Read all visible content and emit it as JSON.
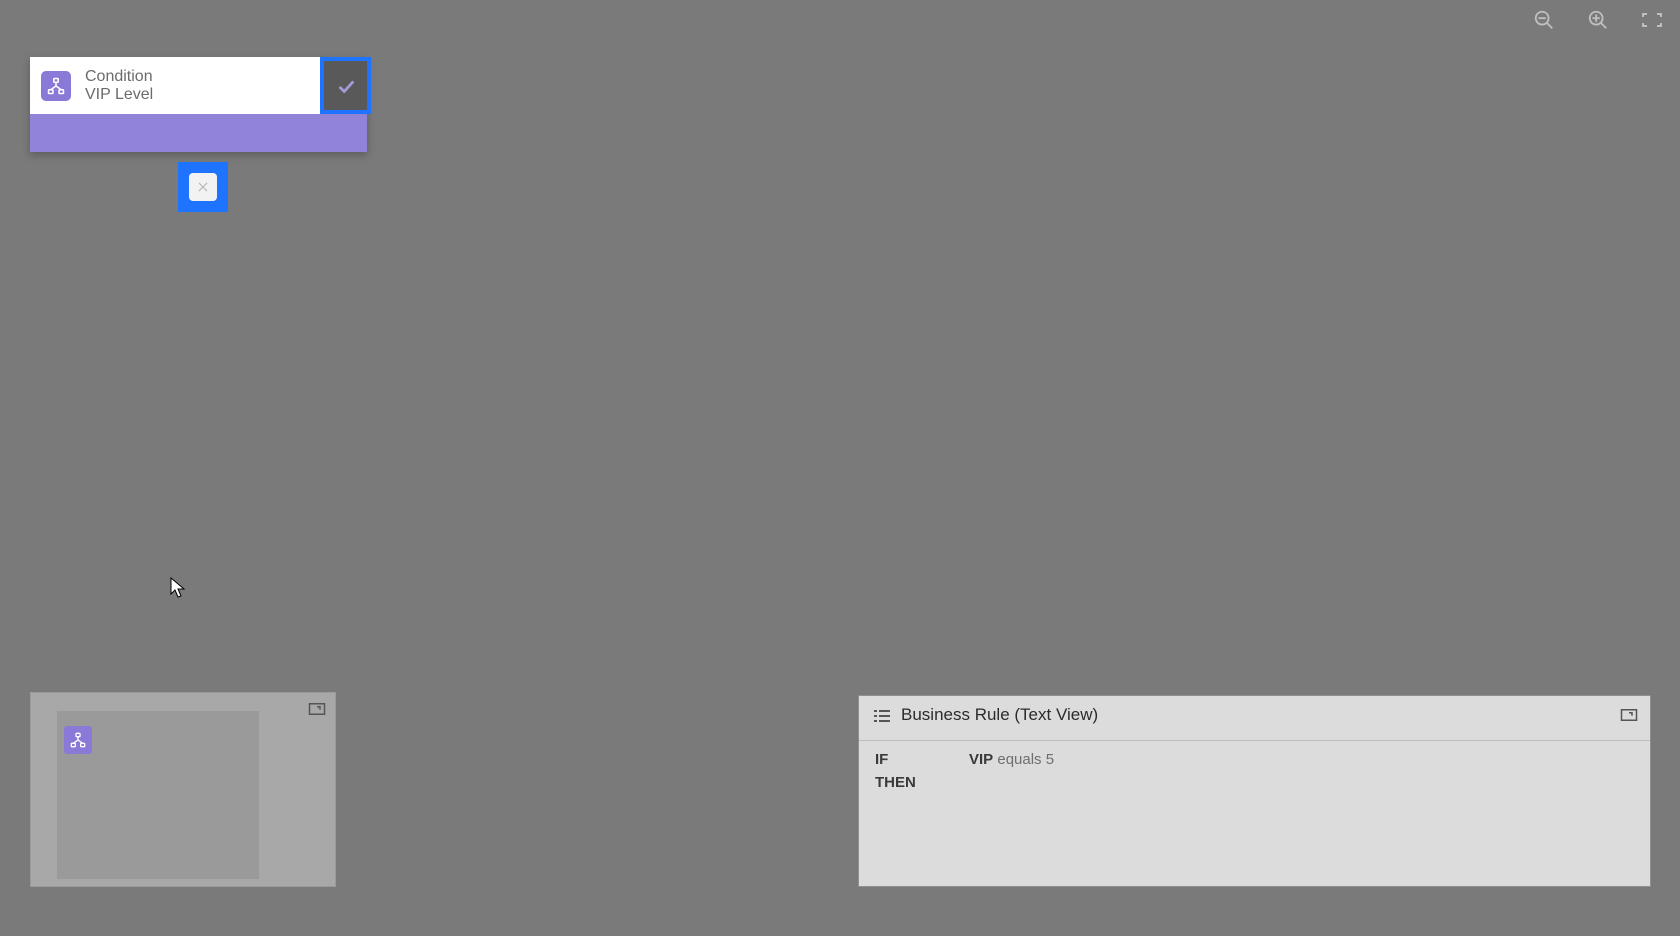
{
  "toolbar": {
    "zoom_out": "zoom-out",
    "zoom_in": "zoom-in",
    "fit": "fit-to-screen"
  },
  "node": {
    "type_label": "Condition",
    "name": "VIP Level"
  },
  "textview": {
    "title": "Business Rule (Text View)",
    "if_kw": "IF",
    "then_kw": "THEN",
    "expr_field": "VIP",
    "expr_rest": " equals 5"
  }
}
